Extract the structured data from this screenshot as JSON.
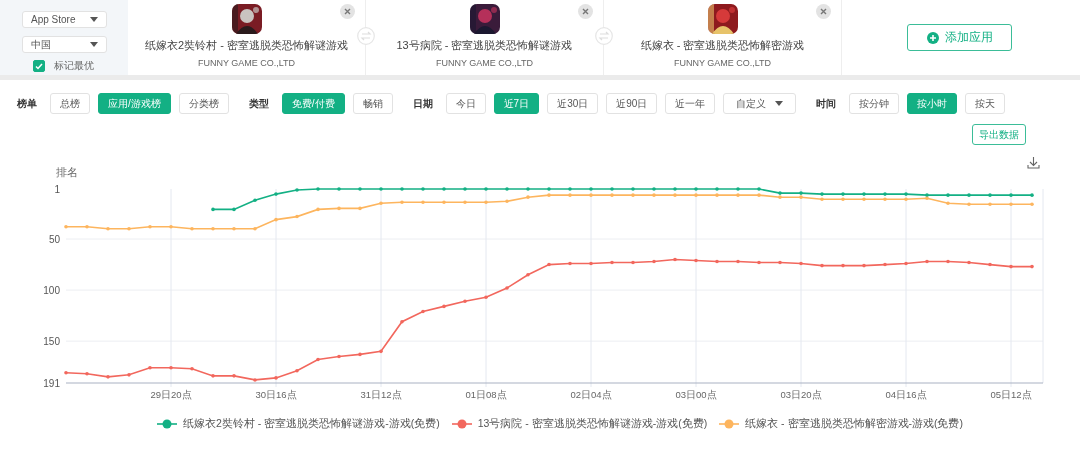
{
  "sidebar": {
    "store_select": "App Store",
    "region_select": "中国",
    "mark_best": {
      "label": "标记最优",
      "checked": true
    }
  },
  "apps": [
    {
      "name": "纸嫁衣2奘铃村 - 密室逃脱类恐怖解谜游戏",
      "developer": "FUNNY GAME CO.,LTD"
    },
    {
      "name": "13号病院 - 密室逃脱类恐怖解谜游戏",
      "developer": "FUNNY GAME CO.,LTD"
    },
    {
      "name": "纸嫁衣 - 密室逃脱类恐怖解密游戏",
      "developer": "FUNNY GAME CO.,LTD"
    }
  ],
  "add_button": "添加应用",
  "filters": [
    {
      "label": "榜单",
      "options": [
        {
          "label": "总榜",
          "selected": false,
          "kind": "plain"
        },
        {
          "label": "应用/游戏榜",
          "selected": true,
          "kind": "plain"
        },
        {
          "label": "分类榜",
          "selected": false,
          "kind": "plain"
        }
      ]
    },
    {
      "label": "类型",
      "options": [
        {
          "label": "免费/付费",
          "selected": true,
          "kind": "plain"
        },
        {
          "label": "畅销",
          "selected": false,
          "kind": "plain"
        }
      ]
    },
    {
      "label": "日期",
      "options": [
        {
          "label": "今日",
          "selected": false,
          "kind": "plain"
        },
        {
          "label": "近7日",
          "selected": true,
          "kind": "plain"
        },
        {
          "label": "近30日",
          "selected": false,
          "kind": "plain"
        },
        {
          "label": "近90日",
          "selected": false,
          "kind": "plain"
        },
        {
          "label": "近一年",
          "selected": false,
          "kind": "plain"
        },
        {
          "label": "自定义",
          "selected": false,
          "kind": "dropdown"
        }
      ]
    },
    {
      "label": "时间",
      "options": [
        {
          "label": "按分钟",
          "selected": false,
          "kind": "plain"
        },
        {
          "label": "按小时",
          "selected": true,
          "kind": "plain"
        },
        {
          "label": "按天",
          "selected": false,
          "kind": "plain"
        }
      ]
    }
  ],
  "export_button": "导出数据",
  "chart": {
    "chart_data": {
      "type": "line",
      "ylabel": "排名",
      "categories": [
        null,
        null,
        null,
        null,
        null,
        "29日20点",
        null,
        null,
        null,
        null,
        "30日16点",
        null,
        null,
        null,
        null,
        "31日12点",
        null,
        null,
        null,
        null,
        "01日08点",
        null,
        null,
        null,
        null,
        "02日04点",
        null,
        null,
        null,
        null,
        "03日00点",
        null,
        null,
        null,
        null,
        "03日20点",
        null,
        null,
        null,
        null,
        "04日16点",
        null,
        null,
        null,
        null,
        "05日12点",
        null
      ],
      "ylim": [
        191,
        1
      ],
      "grid": true,
      "yticks": [
        1,
        50,
        100,
        150,
        191
      ],
      "series": [
        {
          "name": "纸嫁衣2奘铃村 - 密室逃脱类恐怖解谜游戏-游戏(免费)",
          "color": "#13b084",
          "values": [
            null,
            null,
            null,
            null,
            null,
            null,
            null,
            21,
            21,
            12,
            6,
            2,
            1,
            1,
            1,
            1,
            1,
            1,
            1,
            1,
            1,
            1,
            1,
            1,
            1,
            1,
            1,
            1,
            1,
            1,
            1,
            1,
            1,
            1,
            5,
            5,
            6,
            6,
            6,
            6,
            6,
            7,
            7,
            7,
            7,
            7,
            7
          ]
        },
        {
          "name": "13号病院 - 密室逃脱类恐怖解谜游戏-游戏(免费)",
          "color": "#f2675d",
          "values": [
            181,
            182,
            185,
            183,
            176,
            176,
            177,
            184,
            184,
            188,
            186,
            179,
            168,
            165,
            163,
            160,
            131,
            121,
            116,
            111,
            107,
            98,
            85,
            75,
            74,
            74,
            73,
            73,
            72,
            70,
            71,
            72,
            72,
            73,
            73,
            74,
            76,
            76,
            76,
            75,
            74,
            72,
            72,
            73,
            75,
            77,
            77
          ]
        },
        {
          "name": "纸嫁衣 - 密室逃脱类恐怖解密游戏-游戏(免费)",
          "color": "#fdb55e",
          "values": [
            38,
            38,
            40,
            40,
            38,
            38,
            40,
            40,
            40,
            40,
            31,
            28,
            21,
            20,
            20,
            15,
            14,
            14,
            14,
            14,
            14,
            13,
            9,
            7,
            7,
            7,
            7,
            7,
            7,
            7,
            7,
            7,
            7,
            7,
            9,
            9,
            11,
            11,
            11,
            11,
            11,
            10,
            15,
            16,
            16,
            16,
            16
          ]
        }
      ]
    }
  }
}
